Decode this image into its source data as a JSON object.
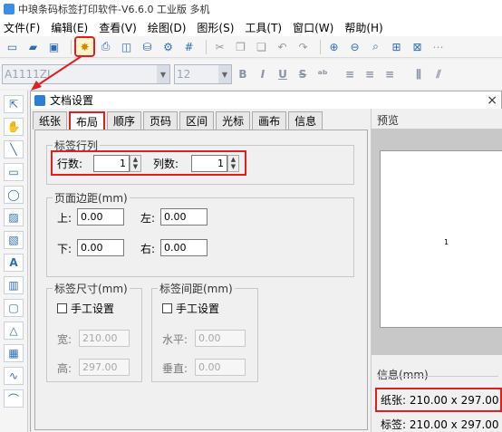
{
  "window": {
    "title": "中琅条码标签打印软件-V6.6.0 工业版 多机"
  },
  "menu": [
    "文件(F)",
    "编辑(E)",
    "查看(V)",
    "绘图(D)",
    "图形(S)",
    "工具(T)",
    "窗口(W)",
    "帮助(H)"
  ],
  "format_bar": {
    "font_name": "A1111ZI",
    "font_size": "12",
    "bold": "B",
    "italic": "I",
    "underline": "U",
    "strike": "S"
  },
  "dialog": {
    "title": "文档设置",
    "close": "×",
    "tabs": [
      "纸张",
      "布局",
      "顺序",
      "页码",
      "区间",
      "光标",
      "画布",
      "信息"
    ],
    "active_tab": "布局",
    "rows_cols": {
      "legend": "标签行列",
      "rows_label": "行数:",
      "rows_value": "1",
      "cols_label": "列数:",
      "cols_value": "1"
    },
    "margins": {
      "legend": "页面边距(mm)",
      "top_label": "上:",
      "top": "0.00",
      "left_label": "左:",
      "left": "0.00",
      "bottom_label": "下:",
      "bottom": "0.00",
      "right_label": "右:",
      "right": "0.00"
    },
    "label_size": {
      "legend": "标签尺寸(mm)",
      "manual": "手工设置",
      "width_label": "宽:",
      "width": "210.00",
      "height_label": "高:",
      "height": "297.00"
    },
    "label_gap": {
      "legend": "标签间距(mm)",
      "manual": "手工设置",
      "h_label": "水平:",
      "h": "0.00",
      "v_label": "垂直:",
      "v": "0.00"
    }
  },
  "preview": {
    "label": "预览",
    "page_number": "1"
  },
  "info": {
    "label": "信息(mm)",
    "paper": "纸张: 210.00 x 297.00",
    "label_size": "标签: 210.00 x 297.00"
  }
}
